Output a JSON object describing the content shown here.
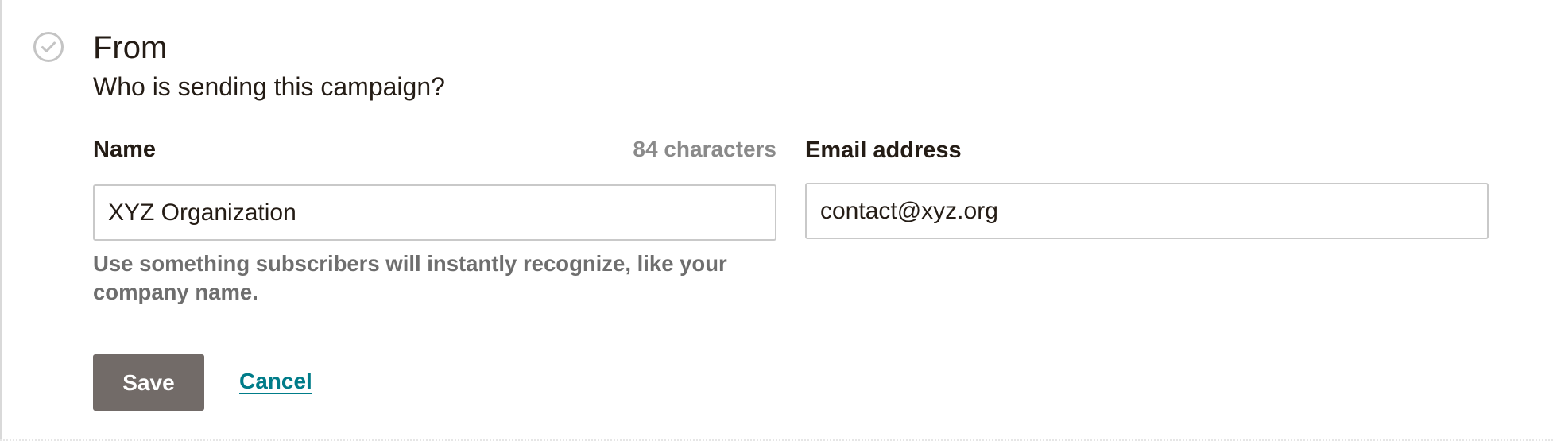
{
  "section": {
    "title": "From",
    "subtitle": "Who is sending this campaign?",
    "status_icon": "check-circle-icon"
  },
  "name_field": {
    "label": "Name",
    "char_count": "84 characters",
    "value": "XYZ Organization",
    "help_text": "Use something subscribers will instantly recognize, like your company name."
  },
  "email_field": {
    "label": "Email address",
    "value": "contact@xyz.org"
  },
  "actions": {
    "save_label": "Save",
    "cancel_label": "Cancel"
  },
  "colors": {
    "save_button_bg": "#726b68",
    "cancel_link": "#007c89",
    "input_border": "#c9c9c9",
    "muted_text": "#6e6e6e"
  }
}
